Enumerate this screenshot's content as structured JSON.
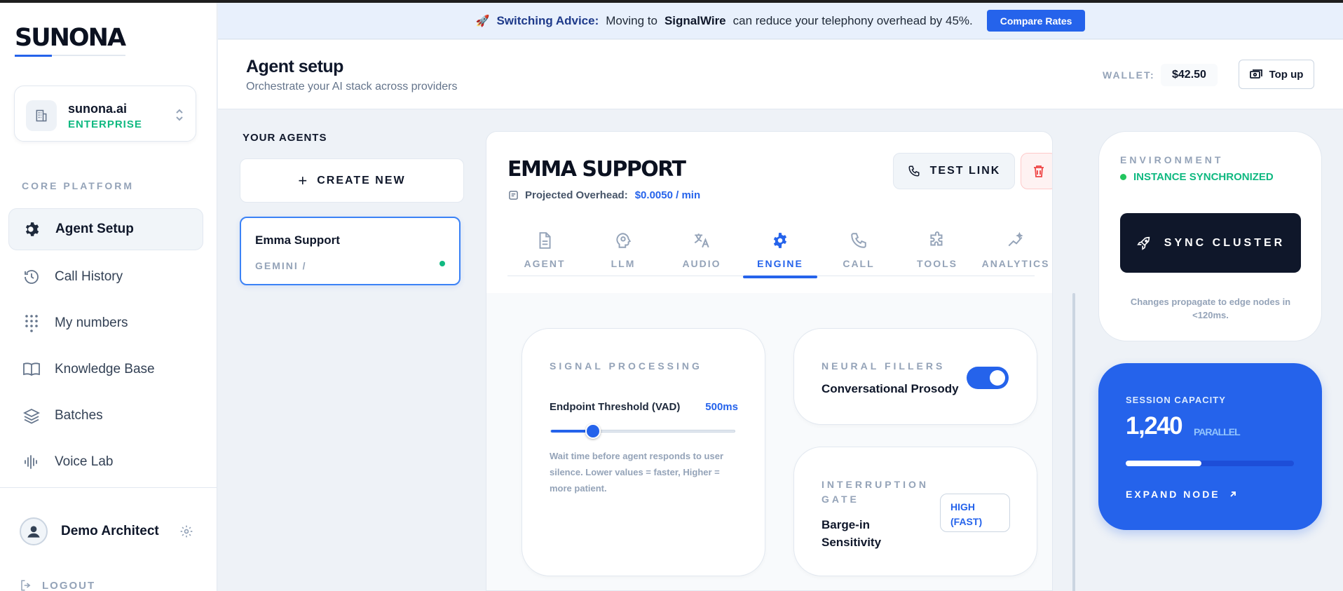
{
  "brand": {
    "logo": "SUNONA",
    "accent": "#2563eb"
  },
  "org": {
    "name": "sunona.ai",
    "tier": "ENTERPRISE",
    "icon": "building-icon"
  },
  "sidebar": {
    "section_label": "CORE PLATFORM",
    "items": [
      {
        "label": "Agent Setup",
        "icon": "gear-icon",
        "active": true
      },
      {
        "label": "Call History",
        "icon": "history-icon"
      },
      {
        "label": "My numbers",
        "icon": "dialpad-icon"
      },
      {
        "label": "Knowledge Base",
        "icon": "book-icon"
      },
      {
        "label": "Batches",
        "icon": "layers-icon"
      },
      {
        "label": "Voice Lab",
        "icon": "waveform-icon"
      }
    ],
    "user": {
      "name": "Demo Architect"
    },
    "logout": "LOGOUT"
  },
  "banner": {
    "emoji": "🚀",
    "title": "Switching Advice:",
    "text_before": "Moving to",
    "provider": "SignalWire",
    "text_after": "can reduce your telephony overhead by 45%.",
    "button": "Compare Rates"
  },
  "header": {
    "title": "Agent setup",
    "subtitle": "Orchestrate your AI stack across providers",
    "wallet_label": "WALLET:",
    "wallet_value": "$42.50",
    "topup_label": "Top up"
  },
  "agents": {
    "label": "YOUR AGENTS",
    "create_label": "CREATE NEW",
    "list": [
      {
        "name": "Emma Support",
        "model": "GEMINI /",
        "status": "online"
      }
    ]
  },
  "agent": {
    "title": "EMMA SUPPORT",
    "overhead_label": "Projected Overhead:",
    "overhead_value": "$0.0050 / min",
    "test_link": "TEST LINK",
    "tabs": [
      {
        "label": "AGENT",
        "icon": "document-icon"
      },
      {
        "label": "LLM",
        "icon": "brain-icon"
      },
      {
        "label": "AUDIO",
        "icon": "translate-icon"
      },
      {
        "label": "ENGINE",
        "icon": "gear-icon",
        "active": true
      },
      {
        "label": "CALL",
        "icon": "phone-icon"
      },
      {
        "label": "TOOLS",
        "icon": "puzzle-icon"
      },
      {
        "label": "ANALYTICS",
        "icon": "sparkle-chart-icon"
      }
    ]
  },
  "engine": {
    "signal": {
      "label": "SIGNAL PROCESSING",
      "vad_label": "Endpoint Threshold (VAD)",
      "vad_value": "500ms",
      "vad_fraction": 0.23,
      "help": "Wait time before agent responds to user silence. Lower values = faster, Higher = more patient."
    },
    "neural": {
      "label": "NEURAL FILLERS",
      "title": "Conversational Prosody",
      "enabled": true
    },
    "interruption": {
      "label": "INTERRUPTION GATE",
      "title": "Barge-in Sensitivity",
      "value": "HIGH (FAST)"
    }
  },
  "environment": {
    "label": "ENVIRONMENT",
    "status": "INSTANCE SYNCHRONIZED",
    "button": "SYNC CLUSTER",
    "note": "Changes propagate to edge nodes in <120ms."
  },
  "capacity": {
    "label": "SESSION CAPACITY",
    "value": "1,240",
    "unit": "PARALLEL",
    "fraction": 0.45,
    "expand": "EXPAND NODE"
  }
}
